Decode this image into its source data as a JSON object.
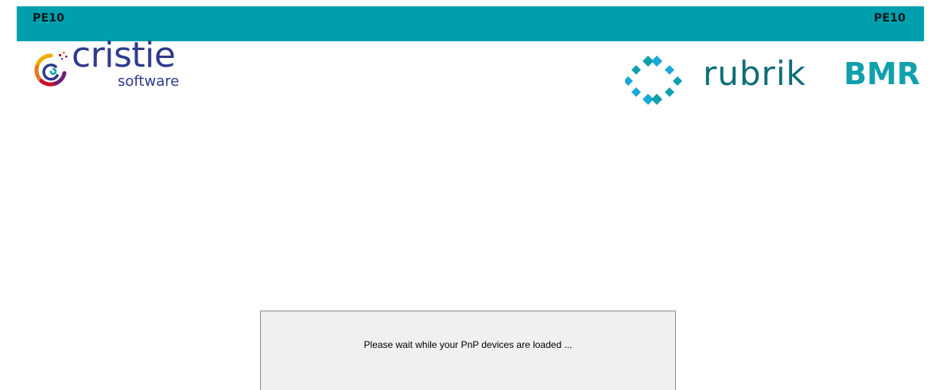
{
  "header": {
    "left_label": "PE10",
    "right_label": "PE10",
    "bar_color": "#009fae"
  },
  "logos": {
    "cristie": {
      "icon": "cristie-swirl-icon",
      "word": "cristie",
      "sub": "software",
      "color": "#2e3a8c"
    },
    "rubrik": {
      "icon": "rubrik-diamond-cluster-icon",
      "word": "rubrik",
      "product": "BMR",
      "color": "#0fa0ac"
    }
  },
  "dialog": {
    "message": "Please wait while your PnP devices are loaded ..."
  }
}
